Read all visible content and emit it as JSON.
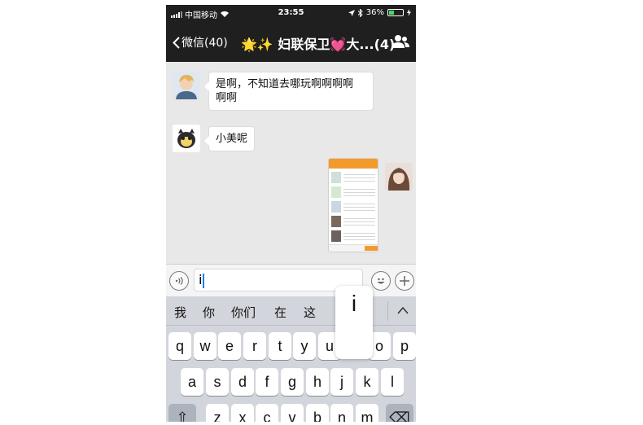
{
  "status_bar": {
    "carrier": "中国移动",
    "time": "23:55",
    "battery_text": "36%",
    "battery_level": 0.36
  },
  "nav": {
    "back_label": "微信(40)",
    "title": "🌟✨ 妇联保卫💓大...(4)"
  },
  "messages": [
    {
      "side": "left",
      "sender_avatar": "boy-avatar",
      "text": "是啊，不知道去哪玩啊啊啊啊\n啊啊"
    },
    {
      "side": "left",
      "sender_avatar": "cat-avatar",
      "text": "小美呢"
    },
    {
      "side": "right",
      "sender_avatar": "girl-avatar",
      "type": "image"
    }
  ],
  "input": {
    "value": "i"
  },
  "candidates": [
    "我",
    "你",
    "你们",
    "在",
    "这"
  ],
  "keyboard": {
    "row1": [
      "q",
      "w",
      "e",
      "r",
      "t",
      "y",
      "u",
      "i",
      "o",
      "p"
    ],
    "row2": [
      "a",
      "s",
      "d",
      "f",
      "g",
      "h",
      "j",
      "k",
      "l"
    ],
    "row3": [
      "z",
      "x",
      "c",
      "v",
      "b",
      "n",
      "m"
    ],
    "shift_label": "⇧",
    "delete_label": "⌫",
    "pressed_key": "i"
  },
  "colors": {
    "bar_dark": "#1f1f1f",
    "chat_bg": "#e8e8e8",
    "keyboard_bg": "#d2d5db",
    "battery_green": "#4cd964",
    "caret_blue": "#1a7cf6"
  }
}
